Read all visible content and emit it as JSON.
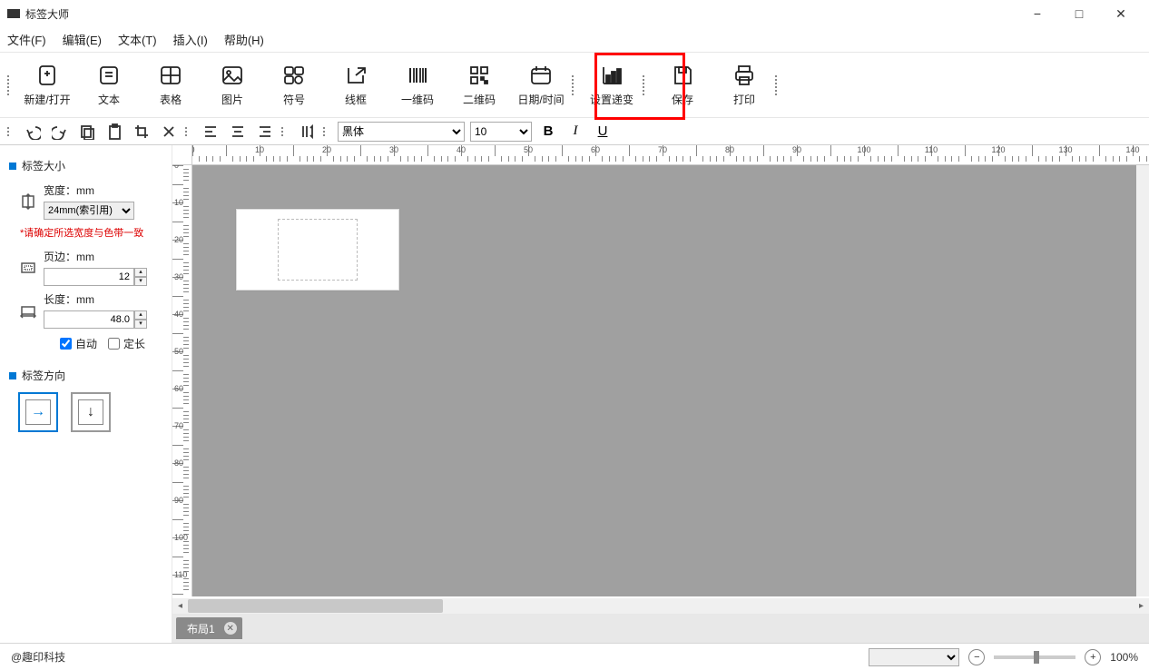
{
  "app": {
    "title": "标签大师"
  },
  "menu": {
    "file": "文件(F)",
    "edit": "编辑(E)",
    "text": "文本(T)",
    "insert": "插入(I)",
    "help": "帮助(H)"
  },
  "tools": {
    "new_open": "新建/打开",
    "text": "文本",
    "table": "表格",
    "image": "图片",
    "symbol": "符号",
    "frame": "线框",
    "barcode1d": "一维码",
    "barcode2d": "二维码",
    "datetime": "日期/时间",
    "increment": "设置递变",
    "save": "保存",
    "print": "打印"
  },
  "format": {
    "font": "黑体",
    "size": "10"
  },
  "sidebar": {
    "size_title": "标签大小",
    "width_label": "宽度：mm",
    "width_value": "24mm(索引用)",
    "width_warning": "*请确定所选宽度与色带一致",
    "margin_label": "页边：mm",
    "margin_value": "12",
    "length_label": "长度：mm",
    "length_value": "48.0",
    "auto": "自动",
    "fixed": "定长",
    "orient_title": "标签方向"
  },
  "tabs": {
    "layout1": "布局1"
  },
  "status": {
    "company": "@趣印科技",
    "zoom": "100%"
  },
  "ruler_h": [
    0,
    10,
    20,
    30,
    40,
    50,
    60,
    70,
    80,
    90,
    100,
    110,
    120,
    130,
    140
  ],
  "ruler_v": [
    0,
    10,
    20,
    30,
    40,
    50,
    60,
    70,
    80,
    90,
    100,
    110
  ]
}
